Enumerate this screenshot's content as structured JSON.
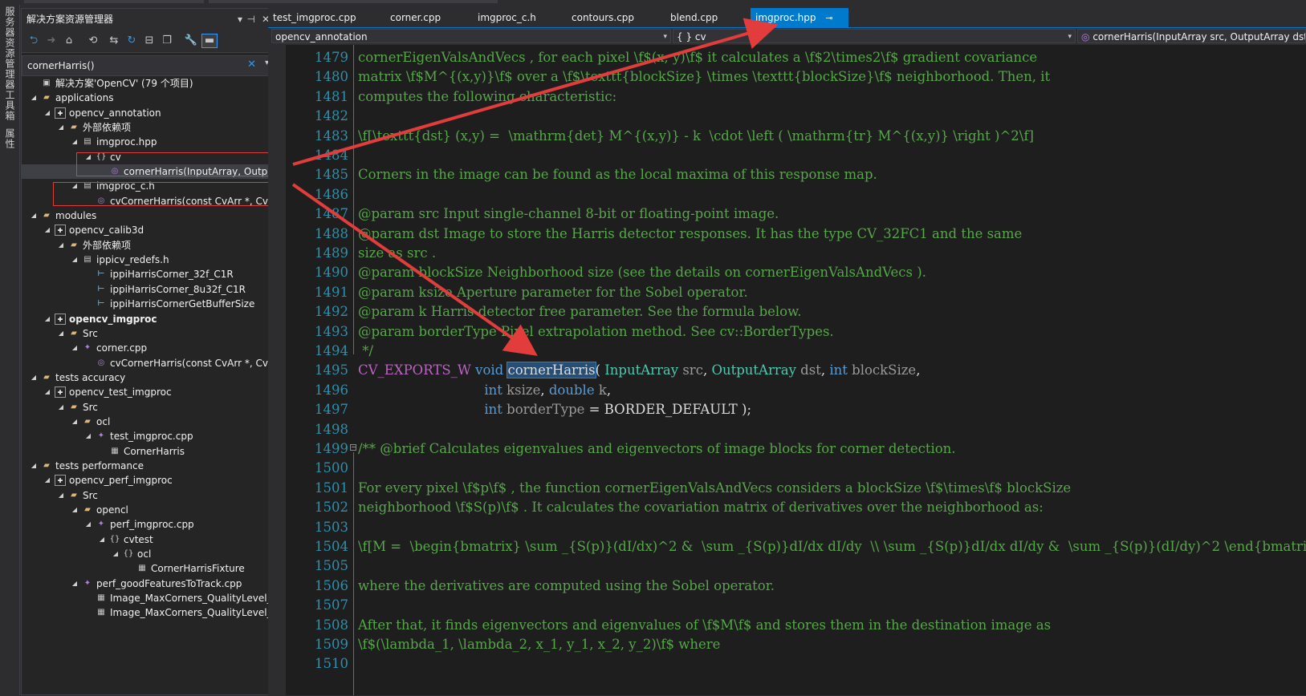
{
  "side_tabs": [
    "服务器资源管理器",
    "工具箱",
    "属性"
  ],
  "solution_explorer": {
    "title": "解决方案资源管理器",
    "pin": "▾",
    "autohide": "⊣",
    "close": "✕",
    "search_value": "cornerHarris()",
    "search_clear": "✕",
    "search_dropdown": "▾",
    "toolbar_icons": [
      "back-icon",
      "forward-icon",
      "home-icon",
      "history-icon",
      "sync-icon",
      "refresh-icon",
      "collapse-all-icon",
      "show-all-files-icon",
      "properties-icon",
      "preview-icon"
    ],
    "tree": [
      {
        "depth": 0,
        "exp": "",
        "icon": "solution-icon",
        "label": "解决方案'OpenCV' (79 个项目)",
        "bold": false
      },
      {
        "depth": 0,
        "exp": "◢",
        "icon": "folder-icon",
        "label": "applications",
        "bold": false
      },
      {
        "depth": 1,
        "exp": "◢",
        "icon": "project-icon",
        "label": "opencv_annotation",
        "bold": false
      },
      {
        "depth": 2,
        "exp": "◢",
        "icon": "external-deps-icon",
        "label": "外部依赖项",
        "bold": false
      },
      {
        "depth": 3,
        "exp": "◢",
        "icon": "header-file-icon",
        "label": "imgproc.hpp",
        "bold": false
      },
      {
        "depth": 4,
        "exp": "◢",
        "icon": "namespace-icon",
        "label": "cv",
        "bold": false
      },
      {
        "depth": 5,
        "exp": "",
        "icon": "function-icon",
        "label": "cornerHarris(InputArray, OutputArray, int, int, double, int)",
        "bold": false,
        "selected": true
      },
      {
        "depth": 3,
        "exp": "◢",
        "icon": "header-file-icon",
        "label": "imgproc_c.h",
        "bold": false
      },
      {
        "depth": 4,
        "exp": "",
        "icon": "function-icon",
        "label": "cvCornerHarris(const CvArr *, CvArr *, int, int, double)",
        "bold": false
      },
      {
        "depth": 0,
        "exp": "◢",
        "icon": "folder-icon",
        "label": "modules",
        "bold": false
      },
      {
        "depth": 1,
        "exp": "◢",
        "icon": "project-icon",
        "label": "opencv_calib3d",
        "bold": false
      },
      {
        "depth": 2,
        "exp": "◢",
        "icon": "external-deps-icon",
        "label": "外部依赖项",
        "bold": false
      },
      {
        "depth": 3,
        "exp": "◢",
        "icon": "header-file-icon",
        "label": "ippicv_redefs.h",
        "bold": false
      },
      {
        "depth": 4,
        "exp": "",
        "icon": "macro-icon",
        "label": "ippiHarrisCorner_32f_C1R",
        "bold": false
      },
      {
        "depth": 4,
        "exp": "",
        "icon": "macro-icon",
        "label": "ippiHarrisCorner_8u32f_C1R",
        "bold": false
      },
      {
        "depth": 4,
        "exp": "",
        "icon": "macro-icon",
        "label": "ippiHarrisCornerGetBufferSize",
        "bold": false
      },
      {
        "depth": 1,
        "exp": "◢",
        "icon": "project-icon",
        "label": "opencv_imgproc",
        "bold": true
      },
      {
        "depth": 2,
        "exp": "◢",
        "icon": "folder-icon",
        "label": "Src",
        "bold": false
      },
      {
        "depth": 3,
        "exp": "◢",
        "icon": "cpp-file-icon",
        "label": "corner.cpp",
        "bold": false
      },
      {
        "depth": 4,
        "exp": "",
        "icon": "function-icon",
        "label": "cvCornerHarris(const CvArr *, CvArr *, int, int, double)",
        "bold": false
      },
      {
        "depth": 0,
        "exp": "◢",
        "icon": "folder-icon",
        "label": "tests accuracy",
        "bold": false
      },
      {
        "depth": 1,
        "exp": "◢",
        "icon": "project-icon",
        "label": "opencv_test_imgproc",
        "bold": false
      },
      {
        "depth": 2,
        "exp": "◢",
        "icon": "folder-icon",
        "label": "Src",
        "bold": false
      },
      {
        "depth": 3,
        "exp": "◢",
        "icon": "folder-icon",
        "label": "ocl",
        "bold": false
      },
      {
        "depth": 4,
        "exp": "◢",
        "icon": "cpp-file-icon",
        "label": "test_imgproc.cpp",
        "bold": false
      },
      {
        "depth": 5,
        "exp": "",
        "icon": "class-icon",
        "label": "CornerHarris",
        "bold": false
      },
      {
        "depth": 0,
        "exp": "◢",
        "icon": "folder-icon",
        "label": "tests performance",
        "bold": false
      },
      {
        "depth": 1,
        "exp": "◢",
        "icon": "project-icon",
        "label": "opencv_perf_imgproc",
        "bold": false
      },
      {
        "depth": 2,
        "exp": "◢",
        "icon": "folder-icon",
        "label": "Src",
        "bold": false
      },
      {
        "depth": 3,
        "exp": "◢",
        "icon": "folder-icon",
        "label": "opencl",
        "bold": false
      },
      {
        "depth": 4,
        "exp": "◢",
        "icon": "cpp-file-icon",
        "label": "perf_imgproc.cpp",
        "bold": false
      },
      {
        "depth": 5,
        "exp": "◢",
        "icon": "namespace-icon",
        "label": "cvtest",
        "bold": false
      },
      {
        "depth": 6,
        "exp": "◢",
        "icon": "namespace-icon",
        "label": "ocl",
        "bold": false
      },
      {
        "depth": 7,
        "exp": "",
        "icon": "class-icon",
        "label": "CornerHarrisFixture",
        "bold": false
      },
      {
        "depth": 3,
        "exp": "◢",
        "icon": "cpp-file-icon",
        "label": "perf_goodFeaturesToTrack.cpp",
        "bold": false
      },
      {
        "depth": 4,
        "exp": "",
        "icon": "class-icon",
        "label": "Image_MaxCorners_QualityLevel_MinDistance_BlockSize_UseHarris",
        "bold": false
      },
      {
        "depth": 4,
        "exp": "",
        "icon": "class-icon",
        "label": "Image_MaxCorners_QualityLevel_MinDistance_BlockSize_UseHarris",
        "bold": false
      }
    ]
  },
  "tabs": [
    {
      "label": "test_imgproc.cpp",
      "active": false
    },
    {
      "label": "corner.cpp",
      "active": false
    },
    {
      "label": "imgproc_c.h",
      "active": false
    },
    {
      "label": "contours.cpp",
      "active": false
    },
    {
      "label": "blend.cpp",
      "active": false
    },
    {
      "label": "imgproc.hpp",
      "active": true,
      "pin": "⊸",
      "close": "✕"
    }
  ],
  "navbar": {
    "project": "opencv_annotation",
    "scope": "{ } cv",
    "member": "cornerHarris(InputArray src, OutputArray dst, int blockSize, int ksize, double k, int borderType)"
  },
  "code_lines": [
    {
      "n": "1479",
      "parts": [
        [
          "c",
          "cornerEigenValsAndVecs , for each pixel \\f$(x, y)\\f$ it calculates a \\f$2\\times2\\f$ gradient covariance"
        ]
      ]
    },
    {
      "n": "1480",
      "parts": [
        [
          "c",
          "matrix \\f$M^{(x,y)}\\f$ over a \\f$\\texttt{blockSize} \\times \\texttt{blockSize}\\f$ neighborhood. Then, it"
        ]
      ]
    },
    {
      "n": "1481",
      "parts": [
        [
          "c",
          "computes the following characteristic:"
        ]
      ]
    },
    {
      "n": "1482",
      "parts": []
    },
    {
      "n": "1483",
      "parts": [
        [
          "c",
          "\\f[\\texttt{dst} (x,y) =  \\mathrm{det} M^{(x,y)} - k  \\cdot \\left ( \\mathrm{tr} M^{(x,y)} \\right )^2\\f]"
        ]
      ]
    },
    {
      "n": "1484",
      "parts": []
    },
    {
      "n": "1485",
      "parts": [
        [
          "c",
          "Corners in the image can be found as the local maxima of this response map."
        ]
      ]
    },
    {
      "n": "1486",
      "parts": []
    },
    {
      "n": "1487",
      "parts": [
        [
          "c",
          "@param src Input single-channel 8-bit or floating-point image."
        ]
      ]
    },
    {
      "n": "1488",
      "parts": [
        [
          "c",
          "@param dst Image to store the Harris detector responses. It has the type CV_32FC1 and the same"
        ]
      ]
    },
    {
      "n": "1489",
      "parts": [
        [
          "c",
          "size as src ."
        ]
      ]
    },
    {
      "n": "1490",
      "parts": [
        [
          "c",
          "@param blockSize Neighborhood size (see the details on cornerEigenValsAndVecs )."
        ]
      ]
    },
    {
      "n": "1491",
      "parts": [
        [
          "c",
          "@param ksize Aperture parameter for the Sobel operator."
        ]
      ]
    },
    {
      "n": "1492",
      "parts": [
        [
          "c",
          "@param k Harris detector free parameter. See the formula below."
        ]
      ]
    },
    {
      "n": "1493",
      "parts": [
        [
          "c",
          "@param borderType Pixel extrapolation method. See cv::BorderTypes."
        ]
      ]
    },
    {
      "n": "1494",
      "parts": [
        [
          "c",
          " */"
        ]
      ]
    },
    {
      "n": "1495",
      "parts": [
        [
          "m",
          "CV_EXPORTS_W"
        ],
        [
          "p",
          " "
        ],
        [
          "k",
          "void"
        ],
        [
          "p",
          " "
        ],
        [
          "h",
          "cornerHarris"
        ],
        [
          "p",
          "( "
        ],
        [
          "t",
          "InputArray"
        ],
        [
          "p",
          " "
        ],
        [
          "g",
          "src"
        ],
        [
          "p",
          ", "
        ],
        [
          "t",
          "OutputArray"
        ],
        [
          "p",
          " "
        ],
        [
          "g",
          "dst"
        ],
        [
          "p",
          ", "
        ],
        [
          "k",
          "int"
        ],
        [
          "p",
          " "
        ],
        [
          "g",
          "blockSize"
        ],
        [
          "p",
          ","
        ]
      ]
    },
    {
      "n": "1496",
      "parts": [
        [
          "p",
          "                              "
        ],
        [
          "k",
          "int"
        ],
        [
          "p",
          " "
        ],
        [
          "g",
          "ksize"
        ],
        [
          "p",
          ", "
        ],
        [
          "k",
          "double"
        ],
        [
          "p",
          " "
        ],
        [
          "g",
          "k"
        ],
        [
          "p",
          ","
        ]
      ]
    },
    {
      "n": "1497",
      "parts": [
        [
          "p",
          "                              "
        ],
        [
          "k",
          "int"
        ],
        [
          "p",
          " "
        ],
        [
          "g",
          "borderType"
        ],
        [
          "p",
          " = "
        ],
        [
          "p",
          "BORDER_DEFAULT"
        ],
        [
          "p",
          " );"
        ]
      ]
    },
    {
      "n": "1498",
      "parts": []
    },
    {
      "n": "1499",
      "parts": [
        [
          "c",
          "/** @brief Calculates eigenvalues and eigenvectors of image blocks for corner detection."
        ]
      ]
    },
    {
      "n": "1500",
      "parts": []
    },
    {
      "n": "1501",
      "parts": [
        [
          "c",
          "For every pixel \\f$p\\f$ , the function cornerEigenValsAndVecs considers a blockSize \\f$\\times\\f$ blockSize"
        ]
      ]
    },
    {
      "n": "1502",
      "parts": [
        [
          "c",
          "neighborhood \\f$S(p)\\f$ . It calculates the covariation matrix of derivatives over the neighborhood as:"
        ]
      ]
    },
    {
      "n": "1503",
      "parts": []
    },
    {
      "n": "1504",
      "parts": [
        [
          "c",
          "\\f[M =  \\begin{bmatrix} \\sum _{S(p)}(dI/dx)^2 &  \\sum _{S(p)}dI/dx dI/dy  \\\\ \\sum _{S(p)}dI/dx dI/dy &  \\sum _{S(p)}(dI/dy)^2 \\end{bmatrix}\\f]"
        ]
      ]
    },
    {
      "n": "1505",
      "parts": []
    },
    {
      "n": "1506",
      "parts": [
        [
          "c",
          "where the derivatives are computed using the Sobel operator."
        ]
      ]
    },
    {
      "n": "1507",
      "parts": []
    },
    {
      "n": "1508",
      "parts": [
        [
          "c",
          "After that, it finds eigenvectors and eigenvalues of \\f$M\\f$ and stores them in the destination image as"
        ]
      ]
    },
    {
      "n": "1509",
      "parts": [
        [
          "c",
          "\\f$(\\lambda_1, \\lambda_2, x_1, y_1, x_2, y_2)\\f$ where"
        ]
      ]
    },
    {
      "n": "1510",
      "parts": []
    }
  ],
  "colors": {
    "accent": "#007acc",
    "comment": "#57a64a",
    "keyword": "#569cd6",
    "type": "#4ec9b0",
    "macro": "#bd63c5",
    "line_number": "#2b91af",
    "annotation_red": "#e23c3c"
  }
}
